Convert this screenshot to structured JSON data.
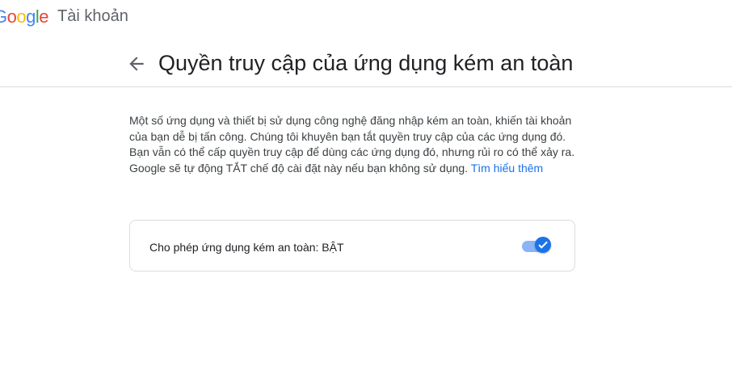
{
  "app": {
    "logo_letters": [
      {
        "char": "G",
        "color": "#4285F4"
      },
      {
        "char": "o",
        "color": "#EA4335"
      },
      {
        "char": "o",
        "color": "#FBBC05"
      },
      {
        "char": "g",
        "color": "#4285F4"
      },
      {
        "char": "l",
        "color": "#34A853"
      },
      {
        "char": "e",
        "color": "#EA4335"
      }
    ],
    "product_name": "Tài khoản"
  },
  "header": {
    "back_icon": "arrow-left-icon",
    "title": "Quyền truy cập của ứng dụng kém an toàn"
  },
  "description": {
    "text": "Một số ứng dụng và thiết bị sử dụng công nghệ đăng nhập kém an toàn, khiến tài khoản của bạn dễ bị tấn công. Chúng tôi khuyên bạn tắt quyền truy cập của các ứng dụng đó. Bạn vẫn có thể cấp quyền truy cập để dùng các ứng dụng đó, nhưng rủi ro có thể xảy ra. Google sẽ tự động TẮT chế độ cài đặt này nếu bạn không sử dụng.",
    "learn_more": "Tìm hiểu thêm"
  },
  "setting": {
    "label": "Cho phép ứng dụng kém an toàn: BẬT",
    "toggle_on": true,
    "toggle_icon": "check-icon",
    "accent_color": "#1a73e8"
  }
}
